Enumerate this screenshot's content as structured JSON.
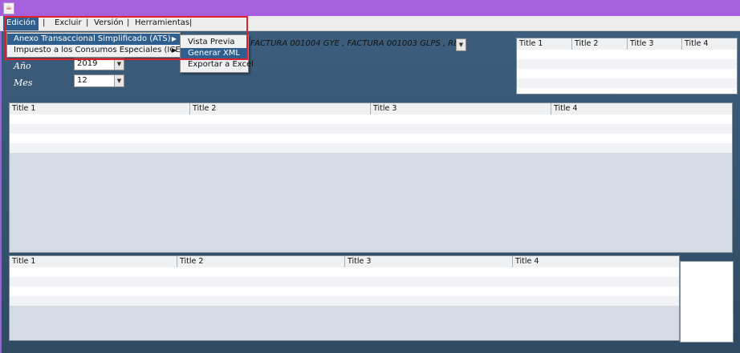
{
  "menubar": {
    "items": [
      "Edición",
      "Excluir",
      "Versión",
      "Herramientas"
    ],
    "separator": "|"
  },
  "edicion_menu": {
    "items": [
      "Anexo Transaccional Simplificado (ATS)",
      "Impuesto a los Consumos Especiales (ICE)"
    ]
  },
  "ats_submenu": {
    "items": [
      "Vista Previa",
      "Generar  XML",
      "Exportar a Excel"
    ]
  },
  "form": {
    "anio_label": "Año",
    "anio_value": "2019",
    "mes_label": "Mes",
    "mes_value": "12",
    "facturas_value": "FACTURA 001004 GYE , FACTURA 001003 GLPS , RE..."
  },
  "tables": {
    "small": {
      "headers": [
        "Title 1",
        "Title 2",
        "Title 3",
        "Title 4"
      ]
    },
    "middle": {
      "headers": [
        "Title 1",
        "Title 2",
        "Title 3",
        "Title 4"
      ]
    },
    "bottom": {
      "headers": [
        "Title 1",
        "Title 2",
        "Title 3",
        "Title 4"
      ]
    }
  },
  "colors": {
    "accent": "#2f5f8e",
    "highlight_border": "#e0202a",
    "title_bar": "#a760dd"
  },
  "icons": {
    "app": "java-coffee-icon",
    "combo_arrow": "chevron-down-icon",
    "submenu_arrow": "triangle-right-icon"
  }
}
